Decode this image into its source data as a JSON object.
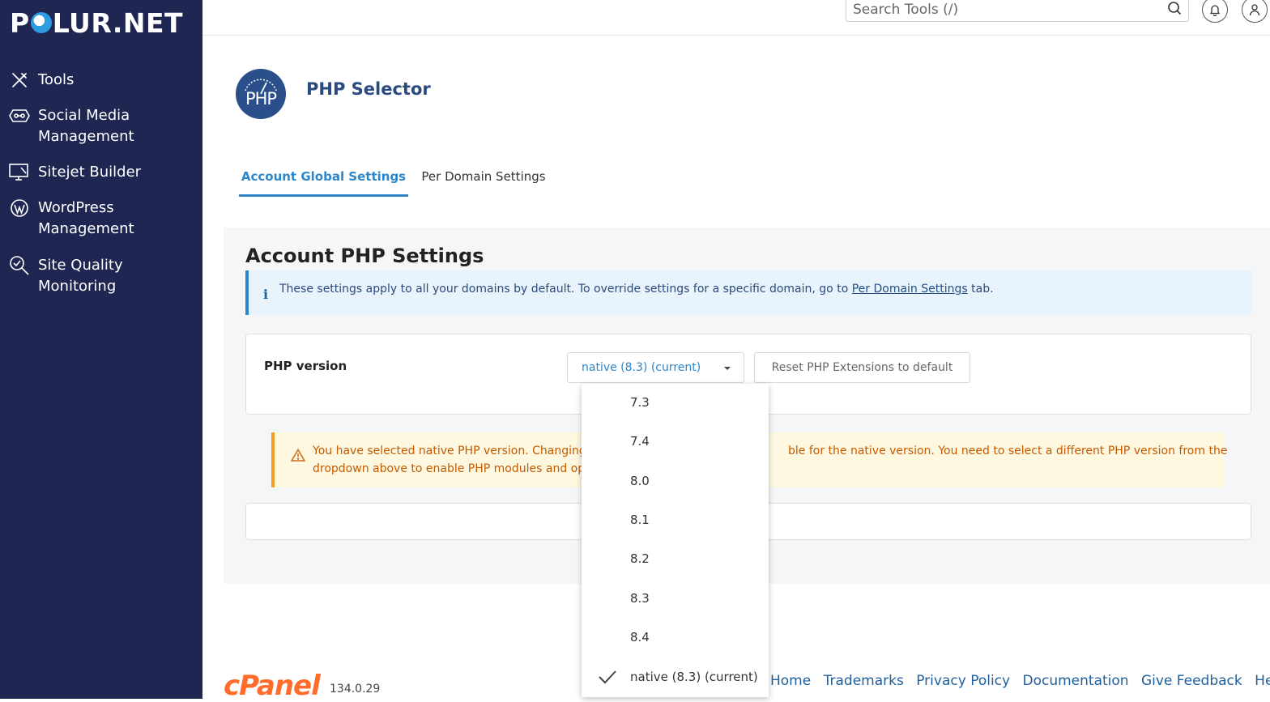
{
  "brand": {
    "logo_prefix": "P",
    "logo_suffix": "LUR.NET"
  },
  "sidebar": {
    "items": [
      {
        "label": "Tools",
        "icon": "tools-icon"
      },
      {
        "label": "Social Media\nManagement",
        "icon": "social-media-icon"
      },
      {
        "label": "Sitejet Builder",
        "icon": "sitejet-icon"
      },
      {
        "label": "WordPress\nManagement",
        "icon": "wordpress-icon"
      },
      {
        "label": "Site Quality\nMonitoring",
        "icon": "site-quality-icon"
      }
    ]
  },
  "topbar": {
    "search_placeholder": "Search Tools (/)"
  },
  "page": {
    "title": "PHP Selector",
    "logo_text": "PHP"
  },
  "tabs": [
    {
      "label": "Account Global Settings",
      "active": true
    },
    {
      "label": "Per Domain Settings",
      "active": false
    }
  ],
  "section": {
    "title": "Account PHP Settings",
    "info_icon": "i",
    "info_text_before": "These settings apply to all your domains by default. To override settings for a specific domain, go to ",
    "info_link": "Per Domain Settings",
    "info_text_after": " tab."
  },
  "php_version": {
    "label": "PHP version",
    "selected": "native (8.3) (current)",
    "reset_label": "Reset PHP Extensions to default",
    "options": [
      "7.3",
      "7.4",
      "8.0",
      "8.1",
      "8.2",
      "8.3",
      "8.4",
      "native (8.3) (current)"
    ]
  },
  "warning": {
    "line1_left": "You have selected native PHP version. Changing PH",
    "line1_right": "ble for the native version. You need to select a different PHP version from the",
    "line2_left": "dropdown above to enable PHP modules and opti"
  },
  "footer": {
    "cpanel_logo": "cPanel",
    "version": "134.0.29",
    "links": [
      "Home",
      "Trademarks",
      "Privacy Policy",
      "Documentation",
      "Give Feedback",
      "Help"
    ]
  },
  "colors": {
    "sidebar_bg": "#1f2651",
    "accent": "#2d86c9",
    "warning": "#c45a00",
    "cpanel": "#ff6c2c"
  }
}
